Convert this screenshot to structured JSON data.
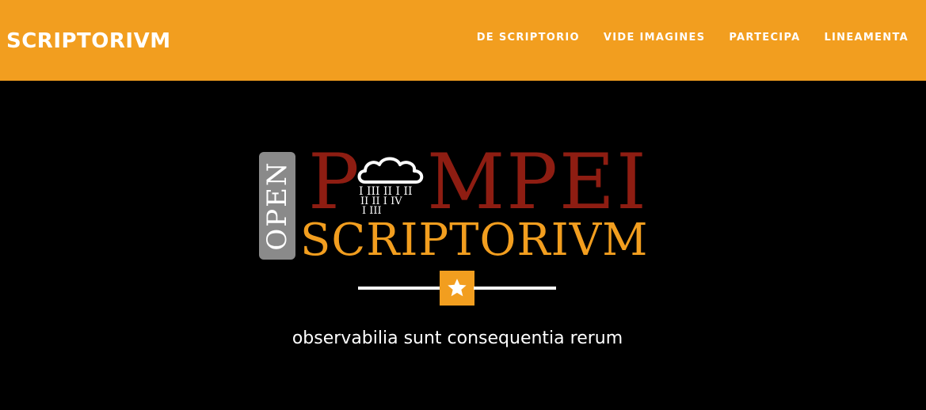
{
  "header": {
    "brand": "SCRIPTORIVM",
    "nav": [
      {
        "label": "DE SCRIPTORIO"
      },
      {
        "label": "VIDE IMAGINES"
      },
      {
        "label": "PARTECIPA"
      },
      {
        "label": "LINEAMENTA"
      }
    ],
    "bg_color": "#F29E1F"
  },
  "hero": {
    "logo": {
      "open": "OPEN",
      "pompei_first": "P",
      "pompei_rest": "MPEI",
      "scriptorivm": "SCRIPTORIVM",
      "cloud_glyph_rows": [
        "I III II I II",
        "II II I IV",
        "I III"
      ],
      "colors": {
        "pompei": "#8e1d12",
        "scriptorivm": "#F29E1F",
        "badge": "#8a8a8a"
      }
    },
    "divider_icon": "star-icon",
    "tagline": "observabilia sunt consequentia rerum"
  }
}
